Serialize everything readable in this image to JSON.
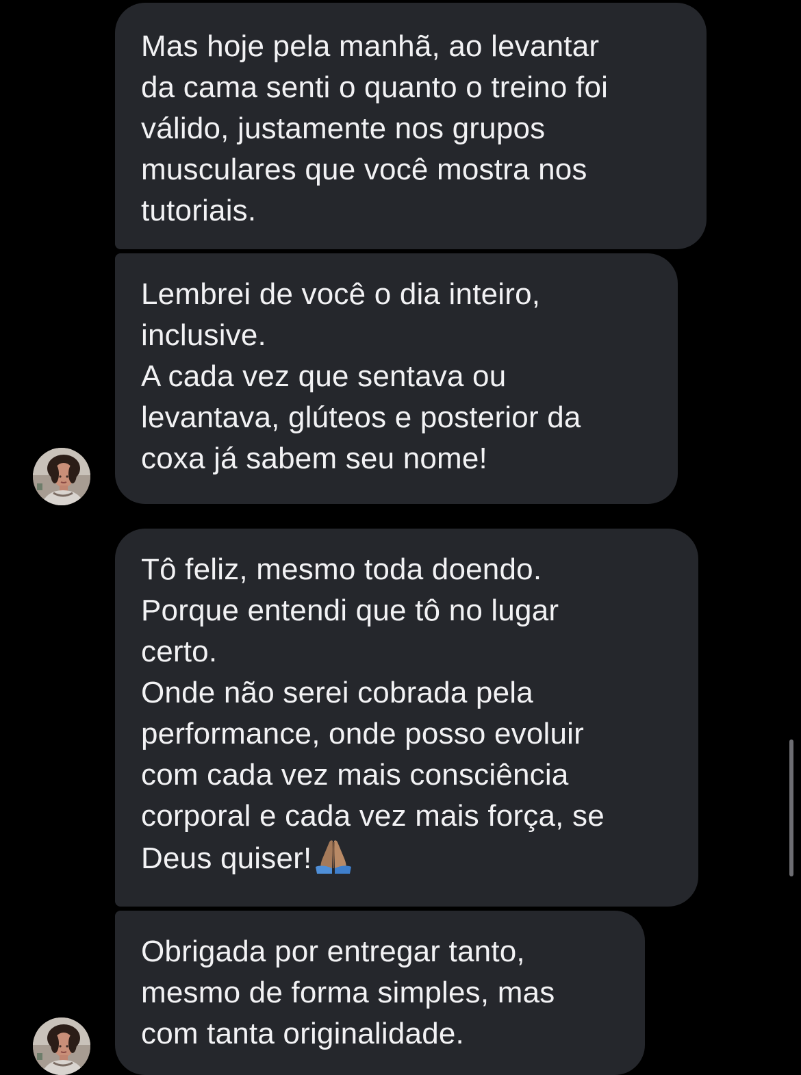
{
  "thread": {
    "messages": [
      {
        "lines": [
          "Mas hoje pela manhã, ao levantar",
          "da cama senti o quanto o treino foi",
          "válido, justamente nos grupos",
          "musculares que você mostra nos",
          "tutoriais."
        ]
      },
      {
        "lines": [
          "Lembrei de você o dia inteiro,",
          "inclusive.",
          "A cada vez que sentava ou",
          "levantava, glúteos e posterior da",
          "coxa já sabem seu nome!"
        ]
      },
      {
        "lines": [
          "Tô feliz, mesmo toda doendo.",
          "Porque entendi que tô no lugar",
          "certo.",
          "Onde não serei cobrada pela",
          "performance, onde posso evoluir",
          "com cada vez mais consciência",
          "corporal e cada vez mais força, se",
          "Deus quiser!"
        ],
        "trailing_emoji": "praying-hands-icon"
      },
      {
        "lines": [
          "Obrigada por entregar tanto,",
          "mesmo de forma simples, mas",
          "com tanta originalidade."
        ]
      }
    ]
  },
  "colors": {
    "background": "#000000",
    "bubble": "#25272c",
    "text": "#f2f2f4",
    "scrollbar": "#6d6d72"
  }
}
